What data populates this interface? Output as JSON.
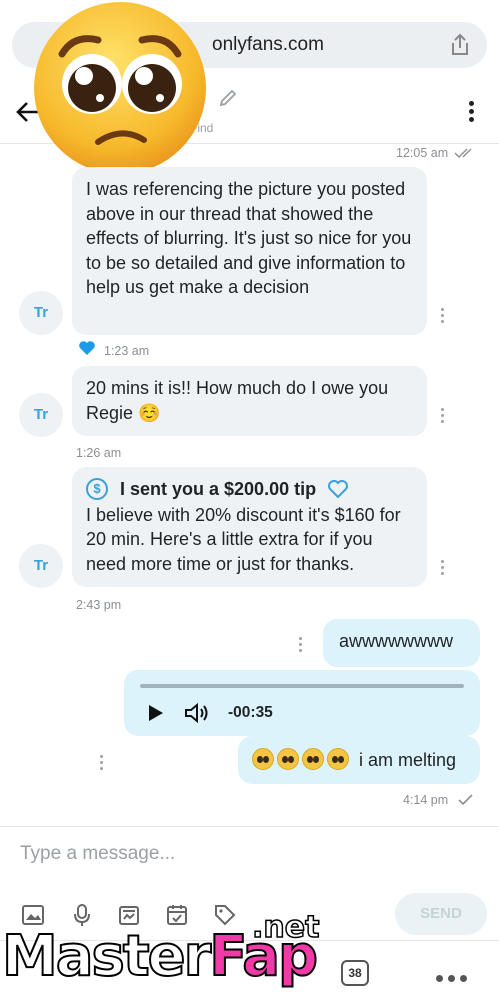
{
  "browser": {
    "url": "onlyfans.com"
  },
  "header": {
    "find_label": "Find"
  },
  "messages": {
    "top_time": "12:05 am",
    "m1": {
      "avatar": "Tr",
      "text": "I was referencing the picture you posted above in our thread that showed the effects of blurring. It's just so nice for you to be so detailed and give information to help us get make a decision",
      "time": "1:23 am"
    },
    "m2": {
      "avatar": "Tr",
      "text": "20 mins it is!! How much do I owe you Regie ☺️",
      "time": "1:26 am"
    },
    "m3": {
      "avatar": "Tr",
      "tip_title": "I sent you a $200.00 tip",
      "text": "I believe with 20% discount it's $160 for 20 min. Here's a little extra for if you need more time or just for thanks.",
      "time": "2:43 pm"
    },
    "out1": {
      "text": "awwwwwwww"
    },
    "audio": {
      "time": "-00:35"
    },
    "out2": {
      "text": "i am melting"
    },
    "last_time": "4:14 pm"
  },
  "composer": {
    "placeholder": "Type a message...",
    "send_label": "SEND"
  },
  "nav": {
    "badge": "38"
  },
  "watermark": {
    "part1": "Master",
    "part2": "Fap",
    "suffix": ".net"
  },
  "colors": {
    "accent": "#3aa0d8",
    "incoming_bubble": "#eef2f5",
    "outgoing_bubble": "#ddf3fb",
    "heart": "#1e9be8"
  },
  "icons": [
    "share-icon",
    "back-arrow-icon",
    "pencil-icon",
    "kebab-icon",
    "heart-icon",
    "dollar-icon",
    "play-icon",
    "volume-icon",
    "image-icon",
    "microphone-icon",
    "vault-icon",
    "calendar-icon",
    "price-tag-icon"
  ]
}
